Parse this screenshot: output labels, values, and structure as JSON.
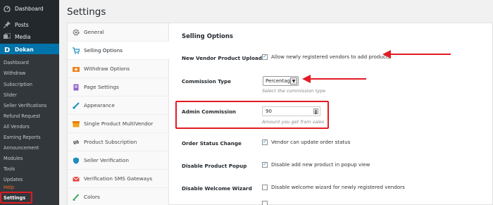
{
  "sidebar": {
    "items": [
      {
        "label": "Dashboard",
        "icon": "dashboard-icon"
      },
      {
        "label": "Posts",
        "icon": "pin-icon"
      },
      {
        "label": "Media",
        "icon": "media-icon"
      },
      {
        "label": "Dokan",
        "icon": "dokan-logo-icon"
      }
    ],
    "subitems": [
      "Dashboard",
      "Withdraw",
      "Subscription",
      "Slider",
      "Seller Verifications",
      "Refund Request",
      "All Vendors",
      "Earning Reports",
      "Announcement",
      "Modules",
      "Tools",
      "Updates",
      "Help",
      "Settings"
    ]
  },
  "page_title": "Settings",
  "tabs": [
    {
      "label": "General",
      "icon": "gear-icon"
    },
    {
      "label": "Selling Options",
      "icon": "cart-icon"
    },
    {
      "label": "Withdraw Options",
      "icon": "withdraw-icon"
    },
    {
      "label": "Page Settings",
      "icon": "page-icon"
    },
    {
      "label": "Appearance",
      "icon": "brush-icon"
    },
    {
      "label": "Single Product MultiVendor",
      "icon": "multivendor-icon"
    },
    {
      "label": "Product Subscription",
      "icon": "subscription-icon"
    },
    {
      "label": "Seller Verification",
      "icon": "shield-icon"
    },
    {
      "label": "Verification SMS Gateways",
      "icon": "mail-icon"
    },
    {
      "label": "Colors",
      "icon": "paint-icon"
    }
  ],
  "section": {
    "title": "Selling Options",
    "new_vendor": {
      "label": "New Vendor Product Upload",
      "checkbox": "Allow newly registered vendors to add products",
      "checked": true
    },
    "commission_type": {
      "label": "Commission Type",
      "value": "Percentage",
      "desc": "Select the commission type"
    },
    "admin_commission": {
      "label": "Admin Commission",
      "value": "90",
      "desc": "Amount you get from sales"
    },
    "order_status": {
      "label": "Order Status Change",
      "checkbox": "Vendor can update order status",
      "checked": true
    },
    "disable_popup": {
      "label": "Disable Product Popup",
      "checkbox": "Disable add new product in popup view",
      "checked": true
    },
    "disable_wizard": {
      "label": "Disable Welcome Wizard",
      "checkbox": "Disable welcome wizard for newly registered vendors",
      "checked": false
    }
  },
  "colors": {
    "accent": "#0073aa",
    "highlight": "#e21b24",
    "sidebar_bg": "#23282d"
  }
}
